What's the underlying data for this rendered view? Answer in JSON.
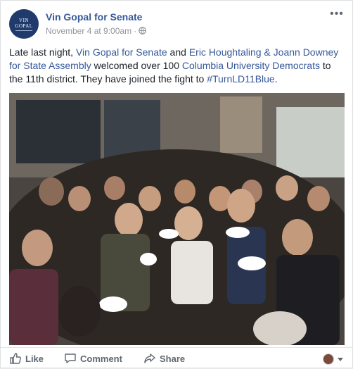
{
  "post": {
    "avatar_lines": [
      "VIN",
      "GOPAL"
    ],
    "page_name": "Vin Gopal for Senate",
    "timestamp": "November 4 at 9:00am",
    "privacy_icon": "globe-icon",
    "more_icon": "ellipsis-icon",
    "text": {
      "part1": "Late last night, ",
      "link1": "Vin Gopal for Senate",
      "part2": " and ",
      "link2": "Eric Houghtaling & Joann Downey for State Assembly",
      "part3": " welcomed over 100 ",
      "link3": "Columbia University Democrats",
      "part4": " to the 11th district. They have joined the fight to ",
      "link4": "#TurnLD11Blue",
      "part5": "."
    },
    "photo_icon": "group-photo-icon"
  },
  "actions": {
    "like": "Like",
    "comment": "Comment",
    "share": "Share"
  },
  "colors": {
    "link": "#365899",
    "text": "#1d2129",
    "meta": "#90949c",
    "avatar_bg": "#1f3a6b"
  }
}
